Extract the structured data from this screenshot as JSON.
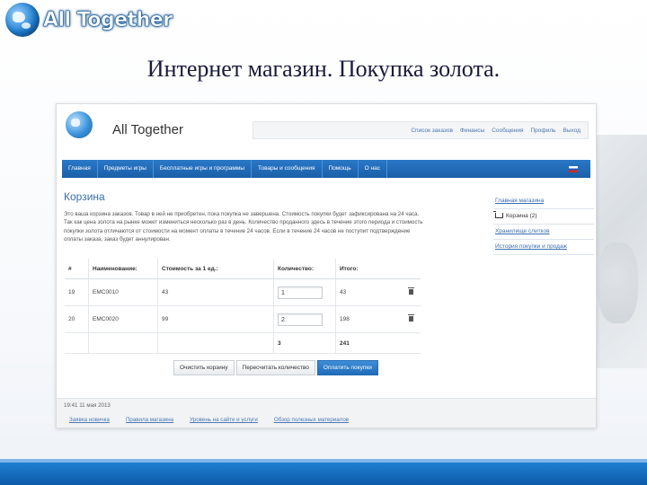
{
  "slide": {
    "logo_text": "All Together",
    "title": "Интернет магазин. Покупка золота."
  },
  "site": {
    "name": "All Together",
    "user_links": [
      "Список заказов",
      "Финансы",
      "Сообщения",
      "Профиль",
      "Выход"
    ],
    "nav_items": [
      "Главная",
      "Предметы игры",
      "Бесплатные игры и программы",
      "Товары и сообщения",
      "Помощь",
      "О нас"
    ],
    "page_heading": "Корзина",
    "intro_text": "Это ваша корзина заказов. Товар в ней не приобретен, пока покупка не завершена. Стоимость покупки будет зафиксирована на 24 часа. Так как цена золота на рынке может измениться несколько раз в день. Количество проданного здесь в течение этого периода и стоимость покупки золота отличаются от стоимости на момент оплаты в течение 24 часов. Если в течение 24 часов не поступит подтверждение оплаты заказа, заказ будет аннулирован.",
    "sidebar": {
      "links": [
        "Главная магазина",
        "Корзина (2)",
        "Хранилище слитков",
        "История покупки и продаж"
      ]
    },
    "cart": {
      "headers": [
        "#",
        "Наименование:",
        "Стоимость за 1 ед.:",
        "Количество:",
        "Итого:"
      ],
      "rows": [
        {
          "num": "19",
          "name": "EMC0010",
          "price": "43",
          "qty": "1",
          "total": "43"
        },
        {
          "num": "20",
          "name": "EMC0020",
          "price": "99",
          "qty": "2",
          "total": "198"
        }
      ],
      "total_qty": "3",
      "total_sum": "241"
    },
    "buttons": {
      "clear": "Очистить корзину",
      "recalc": "Пересчитать количество",
      "pay": "Оплатить покупки"
    },
    "footer": {
      "date": "19:41 11 мая 2013",
      "links": [
        "Заявка новичка",
        "Правила магазина",
        "Уровень на сайте и услуги",
        "Обзор полезных материалов"
      ]
    }
  },
  "colors": {
    "nav_blue": "#1f6cb8",
    "link_blue": "#3a6fae",
    "slide_bar": "#1f7fd1"
  }
}
